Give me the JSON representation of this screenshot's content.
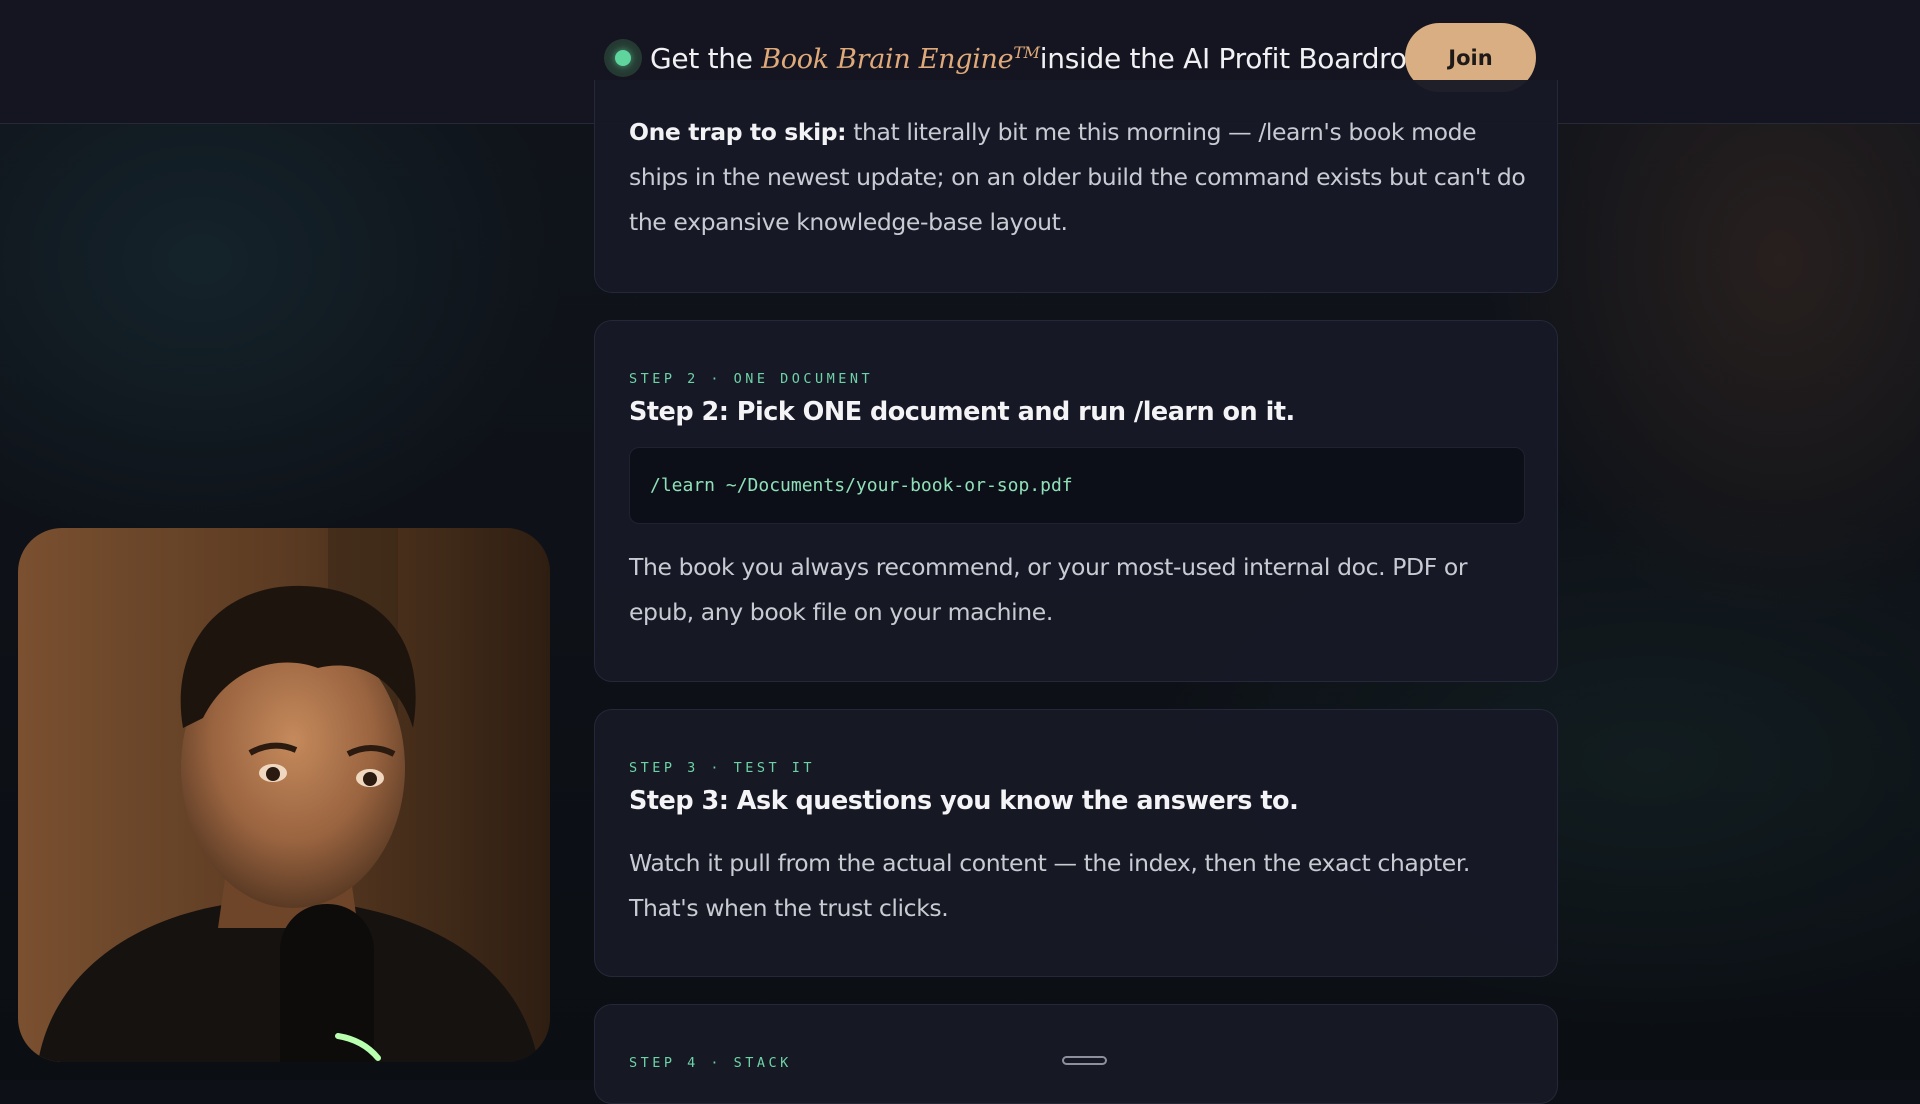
{
  "banner": {
    "prefix": "Get the ",
    "brand": "Book Brain Engine",
    "tm": "TM",
    "suffix": "inside the AI Profit Boardroom",
    "join_label": "Join",
    "status_color": "#5fd49d",
    "accent_color": "#d8ae82"
  },
  "card1": {
    "bold": "One trap to skip:",
    "text": " that literally bit me this morning — /learn's book mode ships in the newest update; on an older build the command exists but can't do the expansive knowledge-base layout."
  },
  "step2": {
    "label": "STEP 2 · ONE DOCUMENT",
    "title": "Step 2: Pick ONE document and run /learn on it.",
    "code": "/learn ~/Documents/your-book-or-sop.pdf",
    "text": "The book you always recommend, or your most-used internal doc. PDF or epub, any book file on your machine."
  },
  "step3": {
    "label": "STEP 3 · TEST IT",
    "title": "Step 3: Ask questions you know the answers to.",
    "text": "Watch it pull from the actual content — the index, then the exact chapter. That's when the trust clicks."
  },
  "step4": {
    "label": "STEP 4 · STACK"
  },
  "colors": {
    "step_label": "#6dd3a6",
    "code_text": "#8fe0b8",
    "card_bg": "#171925"
  }
}
